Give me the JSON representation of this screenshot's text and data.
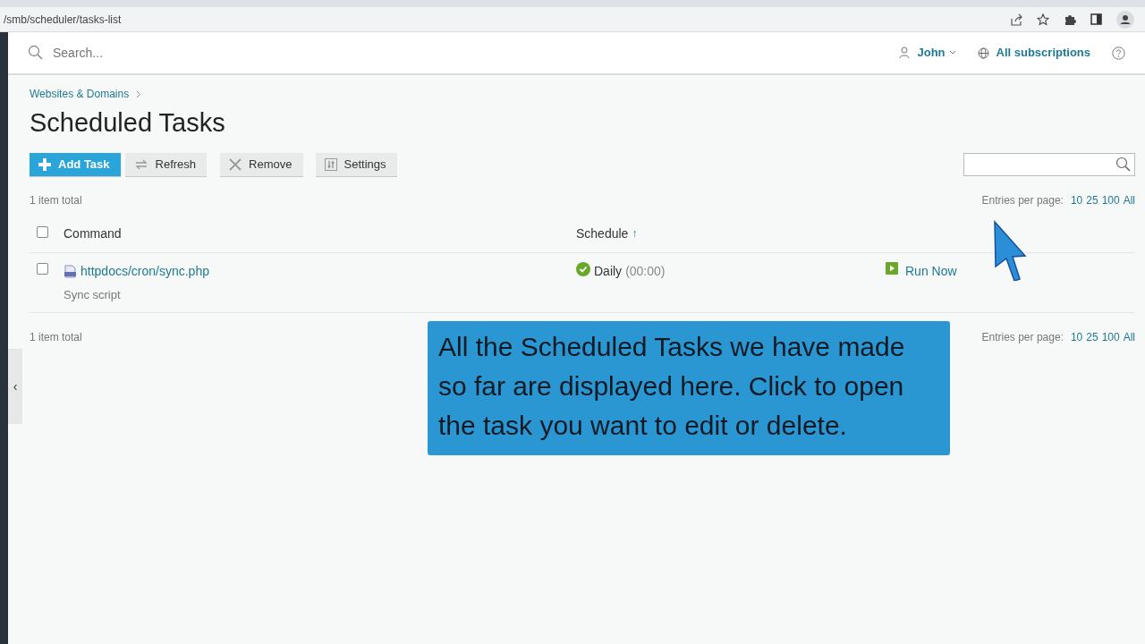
{
  "browser": {
    "url": "/smb/scheduler/tasks-list"
  },
  "header": {
    "search_placeholder": "Search...",
    "user": "John",
    "subscriptions": "All subscriptions"
  },
  "sidebar_toggle": "‹",
  "breadcrumb": [
    "Websites & Domains"
  ],
  "title": "Scheduled Tasks",
  "toolbar": [
    {
      "label": "Add Task",
      "kind": "primary"
    },
    {
      "label": "Refresh",
      "kind": "refresh"
    },
    {
      "label": "Remove",
      "kind": "remove"
    },
    {
      "label": "Settings",
      "kind": "settings"
    }
  ],
  "summary_top": {
    "total": "1 item total",
    "entries_label": "Entries per page:",
    "options": [
      "10",
      "25",
      "100",
      "All"
    ]
  },
  "table": {
    "columns": [
      {
        "label": "Command"
      },
      {
        "label": "Schedule",
        "sort_arrow": "↑"
      }
    ],
    "header_checked": false,
    "rows": [
      {
        "checked": false,
        "command": "httpdocs/cron/sync.php",
        "description": "Sync script",
        "schedule": "Daily",
        "time": "(00:00)",
        "action": "Run Now"
      }
    ]
  },
  "summary_bottom": {
    "total": "1 item total",
    "entries_label": "Entries per page:",
    "options": [
      "10",
      "25",
      "100",
      "All"
    ]
  },
  "callout": "All the Scheduled Tasks we have made so far are displayed here. Click to open the task you want to edit or delete."
}
